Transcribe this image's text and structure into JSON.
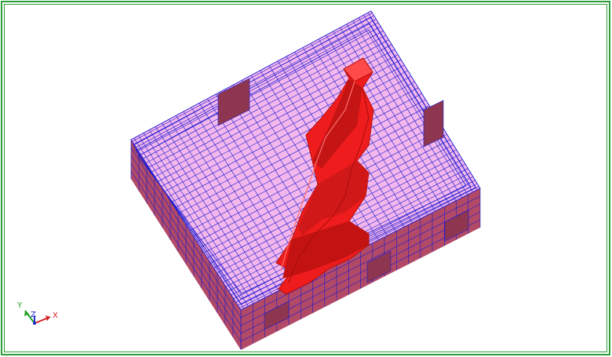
{
  "viewer": {
    "frame_color": "#2e9e3a",
    "background": "#ffffff"
  },
  "model": {
    "grid_color": "#1a1ad0",
    "block_top_fill": "#f3b7ec",
    "block_side_fill": "#b24a67",
    "block_side_dark": "#8e3650",
    "orebody_color": "#ee1c1c",
    "orebody_shadow": "#b50d0d",
    "orebody_highlight": "#ff6060"
  },
  "triad": {
    "x_label": "X",
    "y_label": "Y",
    "z_label": "Z",
    "x_color": "#d42020",
    "y_color": "#20a020",
    "z_color": "#2030d0"
  }
}
